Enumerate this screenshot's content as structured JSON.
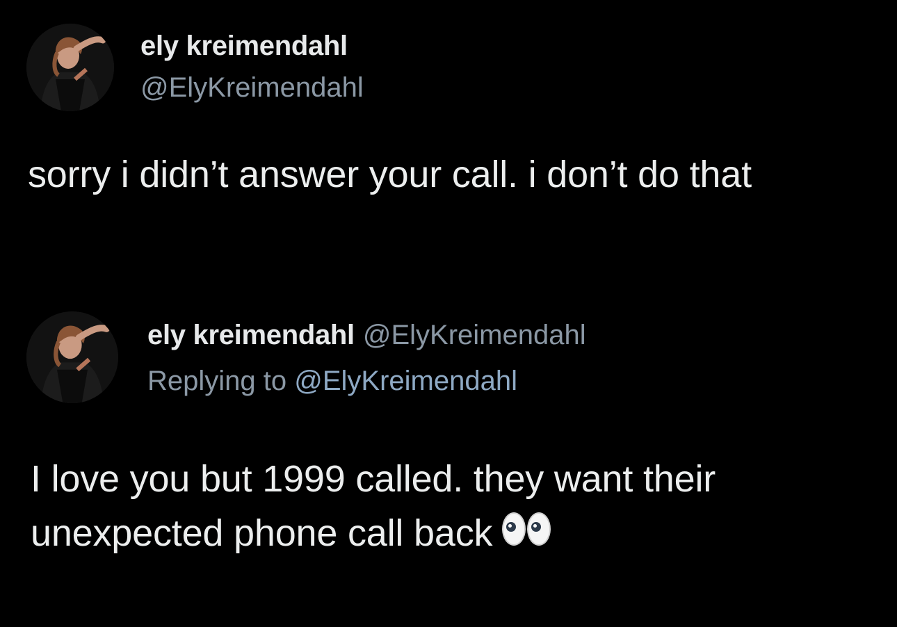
{
  "tweet1": {
    "display_name": "ely kreimendahl",
    "handle": "@ElyKreimendahl",
    "text": "sorry i didn’t answer your call. i don’t do that"
  },
  "tweet2": {
    "display_name": "ely kreimendahl",
    "handle": "@ElyKreimendahl",
    "replying_prefix": "Replying to ",
    "replying_handle": "@ElyKreimendahl",
    "text_line1": "I love you but 1999 called. they want their",
    "text_line2": "unexpected phone call back",
    "emoji_icon": "eyes-emoji-icon"
  },
  "colors": {
    "background": "#000000",
    "primary_text": "#e7e9ea",
    "secondary_text": "#8b98a5",
    "link_text": "#8ea9c4"
  }
}
